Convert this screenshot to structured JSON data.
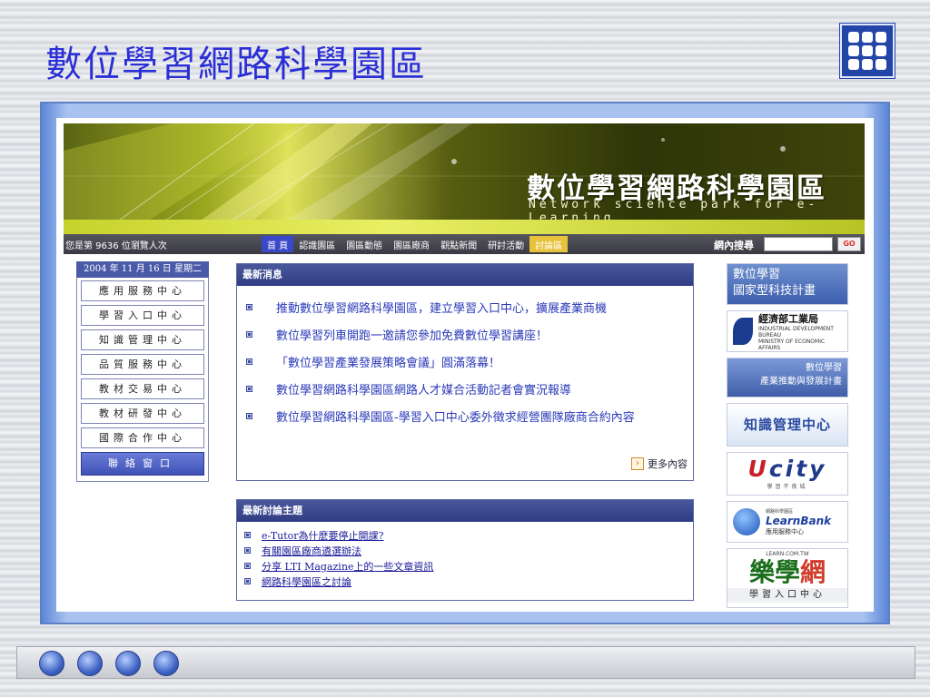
{
  "slide": {
    "title": "數位學習網路科學園區"
  },
  "banner": {
    "title": "數位學習網路科學園區",
    "subtitle": "Network science park for e-Learning"
  },
  "navbar": {
    "visitor_text": "您是第 9636 位瀏覽人次",
    "items": [
      "首 頁",
      "認識園區",
      "園區動態",
      "園區廠商",
      "觀點新聞",
      "研討活動",
      "討論區"
    ],
    "search_label": "網內搜尋",
    "search_value": "",
    "go_label": "GO"
  },
  "left_menu": {
    "date": "2004 年 11 月 16 日 星期二",
    "items": [
      "應用服務中心",
      "學習入口中心",
      "知識管理中心",
      "品質服務中心",
      "教材交易中心",
      "教材研發中心",
      "國際合作中心"
    ],
    "contact": "聯絡窗口"
  },
  "news": {
    "header": "最新消息",
    "items": [
      "推動數位學習網路科學園區，建立學習入口中心，擴展產業商機",
      "數位學習列車開跑一邀請您參加免費數位學習講座！",
      "「數位學習產業發展策略會議」圓滿落幕！",
      "數位學習網路科學園區網路人才媒合活動記者會實況報導",
      "數位學習網路科學園區-學習入口中心委外徵求經營團隊廠商合約內容"
    ],
    "more": "更多內容"
  },
  "discussion": {
    "header": "最新討論主題",
    "items": [
      "e-Tutor為什麼要停止開課?",
      "有關園區廠商遴選辦法",
      "分享 LTI Magazine上的一些文章資訊",
      "網路科學園區之討論"
    ]
  },
  "sidebar": {
    "ad1_line1": "數位學習",
    "ad1_line2": "國家型科技計畫",
    "ad2_title": "經濟部工業局",
    "ad2_en1": "INDUSTRIAL DEVELOPMENT BUREAU",
    "ad2_en2": "MINISTRY OF ECONOMIC AFFAIRS",
    "ad3_line1": "數位學習",
    "ad3_line2": "產業推動與發展計畫",
    "ad4": "知識管理中心",
    "ad5_brand_prefix": "U",
    "ad5_brand": "city",
    "ad5_tagline": "學習不夜城",
    "ad6_top": "網路科學園區",
    "ad6_name": "LearnBank",
    "ad6_sub": "應用服務中心",
    "ad7_url": "LEARN.COM.TW",
    "ad7_big1": "樂",
    "ad7_big2": "學",
    "ad7_big3": "網",
    "ad7_caption": "學習入口中心"
  },
  "colors": {
    "title": "#2a2ed6",
    "accent": "#3b49c8",
    "header_bar": "#303d84",
    "link": "#2a3ab8"
  }
}
